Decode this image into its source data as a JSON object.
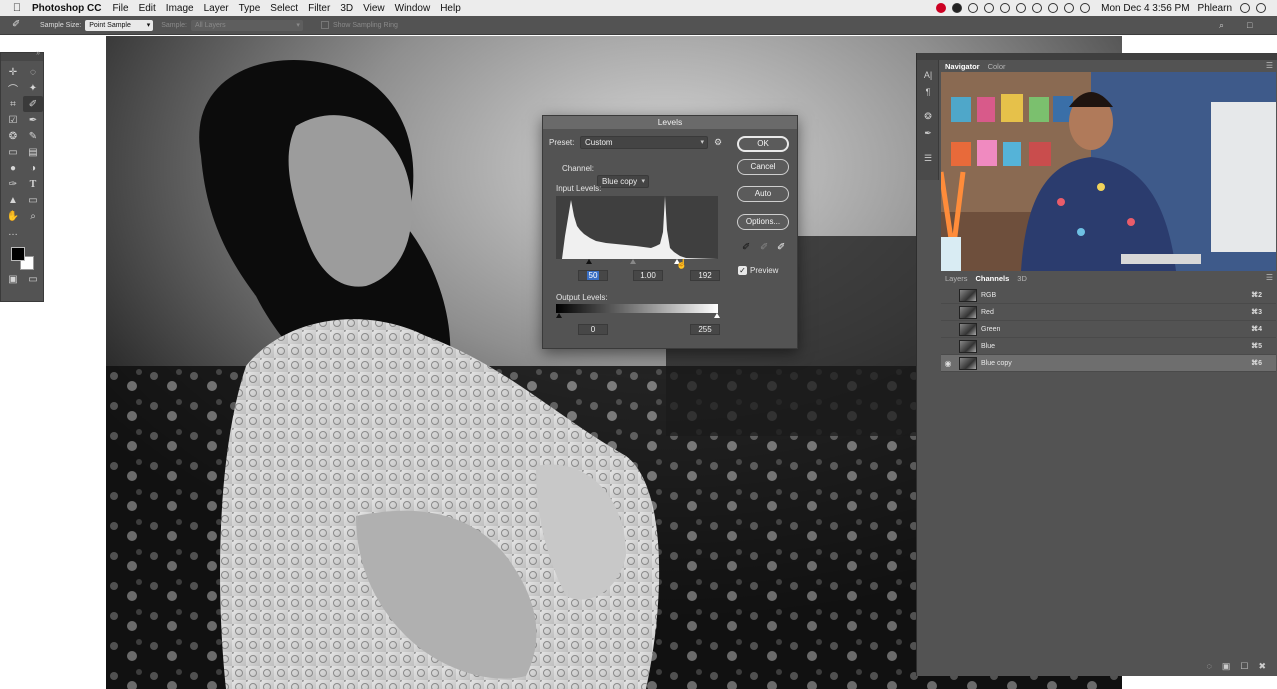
{
  "menubar": {
    "app_name": "Photoshop CC",
    "items": [
      "File",
      "Edit",
      "Image",
      "Layer",
      "Type",
      "Select",
      "Filter",
      "3D",
      "View",
      "Window",
      "Help"
    ],
    "clock": "Mon Dec 4  3:56 PM",
    "user": "Phlearn"
  },
  "options_bar": {
    "sample_size_label": "Sample Size:",
    "sample_size_value": "Point Sample",
    "sample_label": "Sample:",
    "sample_value": "All Layers",
    "show_ring_label": "Show Sampling Ring"
  },
  "levels": {
    "title": "Levels",
    "preset_label": "Preset:",
    "preset_value": "Custom",
    "channel_label": "Channel:",
    "channel_value": "Blue copy",
    "input_levels_label": "Input Levels:",
    "input_black": "50",
    "input_gamma": "1.00",
    "input_white": "192",
    "output_levels_label": "Output Levels:",
    "output_black": "0",
    "output_white": "255",
    "ok_label": "OK",
    "cancel_label": "Cancel",
    "auto_label": "Auto",
    "options_label": "Options...",
    "preview_label": "Preview",
    "preview_checked": true
  },
  "navigator": {
    "tabs": [
      "Navigator",
      "Color"
    ]
  },
  "channels_panel": {
    "tabs": [
      "Layers",
      "Channels",
      "3D"
    ],
    "channels": [
      {
        "name": "RGB",
        "shortcut": "⌘2",
        "visible": false,
        "selected": false
      },
      {
        "name": "Red",
        "shortcut": "⌘3",
        "visible": false,
        "selected": false
      },
      {
        "name": "Green",
        "shortcut": "⌘4",
        "visible": false,
        "selected": false
      },
      {
        "name": "Blue",
        "shortcut": "⌘5",
        "visible": false,
        "selected": false
      },
      {
        "name": "Blue copy",
        "shortcut": "⌘6",
        "visible": true,
        "selected": true
      }
    ]
  }
}
